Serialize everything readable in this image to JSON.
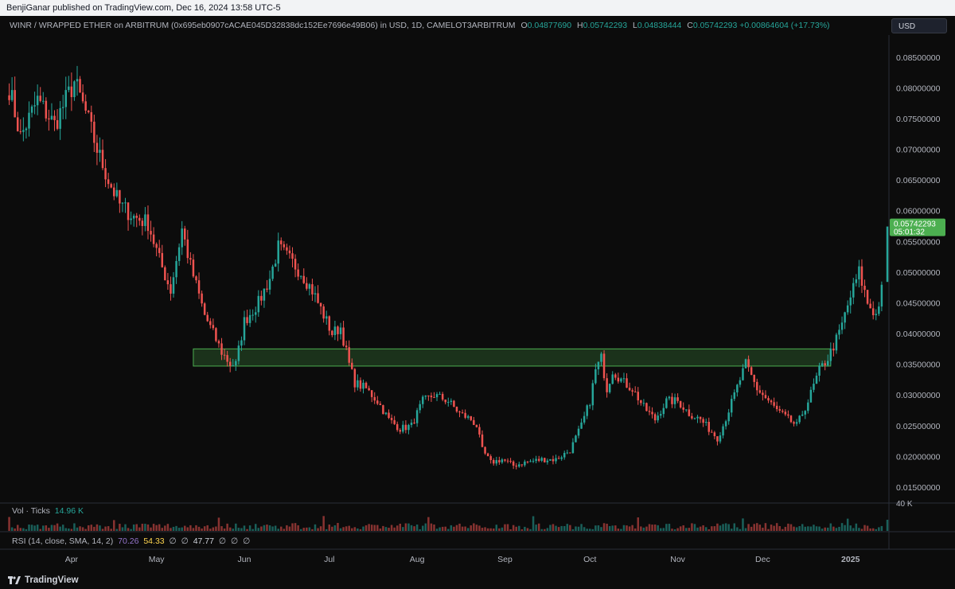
{
  "header": {
    "published": "BenjiGanar published on TradingView.com, Dec 16, 2024 13:58 UTC-5"
  },
  "legend": {
    "symbol": "WINR / WRAPPED ETHER on ARBITRUM (0x695eb0907cACAE045D32838dc152Ee7696e49B06) in USD, 1D, CAMELOT3ARBITRUM",
    "o_label": "O",
    "o_value": "0.04877690",
    "h_label": "H",
    "h_value": "0.05742293",
    "l_label": "L",
    "l_value": "0.04838444",
    "c_label": "C",
    "c_value": "0.05742293",
    "change": "+0.00864604 (+17.73%)"
  },
  "currency_button": "USD",
  "volume_pane": {
    "label": "Vol · Ticks",
    "value": "14.96 K",
    "axis_label": "40 K"
  },
  "rsi_pane": {
    "label": "RSI (14, close, SMA, 14, 2)",
    "v1": "70.26",
    "v2": "54.33",
    "v3": "47.77",
    "placeholder": "∅"
  },
  "footer": {
    "brand": "TradingView"
  },
  "colors": {
    "up": "#26a69a",
    "down": "#ef5350",
    "box_fill": "#1e3a1e",
    "box_stroke": "#4caf50",
    "price_tag": "#4caf50"
  },
  "chart_data": {
    "type": "candlestick",
    "y_ticks": [
      0.015,
      0.02,
      0.025,
      0.03,
      0.035,
      0.04,
      0.045,
      0.05,
      0.055,
      0.06,
      0.065,
      0.07,
      0.075,
      0.08,
      0.085
    ],
    "y_tick_labels": [
      "0.01500000",
      "0.02000000",
      "0.02500000",
      "0.03000000",
      "0.03500000",
      "0.04000000",
      "0.04500000",
      "0.05000000",
      "0.05500000",
      "0.06000000",
      "0.06500000",
      "0.07000000",
      "0.07500000",
      "0.08000000",
      "0.08500000"
    ],
    "ylim": [
      0.0124,
      0.0886
    ],
    "x_labels": [
      "Apr",
      "May",
      "Jun",
      "Jul",
      "Aug",
      "Sep",
      "Oct",
      "Nov",
      "Dec",
      "2025"
    ],
    "x_label_dates": [
      "2024-04-01",
      "2024-05-01",
      "2024-06-01",
      "2024-07-01",
      "2024-08-01",
      "2024-09-01",
      "2024-10-01",
      "2024-11-01",
      "2024-12-01",
      "2025-01-01"
    ],
    "range_start": "2024-03-09",
    "range_end": "2025-01-14",
    "current_price": "0.05742293",
    "countdown": "05:01:32",
    "support_zone": {
      "low": 0.0347,
      "high": 0.0375,
      "start": "2024-05-14",
      "end": "2024-12-25"
    },
    "close_anchors": [
      [
        "2024-03-10",
        0.08
      ],
      [
        "2024-03-14",
        0.072
      ],
      [
        "2024-03-20",
        0.078
      ],
      [
        "2024-03-26",
        0.074
      ],
      [
        "2024-04-02",
        0.081
      ],
      [
        "2024-04-06",
        0.076
      ],
      [
        "2024-04-10",
        0.07
      ],
      [
        "2024-04-14",
        0.065
      ],
      [
        "2024-04-18",
        0.061
      ],
      [
        "2024-04-23",
        0.059
      ],
      [
        "2024-04-28",
        0.058
      ],
      [
        "2024-05-02",
        0.052
      ],
      [
        "2024-05-06",
        0.047
      ],
      [
        "2024-05-10",
        0.057
      ],
      [
        "2024-05-13",
        0.051
      ],
      [
        "2024-05-18",
        0.043
      ],
      [
        "2024-05-24",
        0.037
      ],
      [
        "2024-05-27",
        0.035
      ],
      [
        "2024-05-29",
        0.035
      ],
      [
        "2024-06-01",
        0.042
      ],
      [
        "2024-06-06",
        0.045
      ],
      [
        "2024-06-10",
        0.049
      ],
      [
        "2024-06-13",
        0.054
      ],
      [
        "2024-06-17",
        0.052
      ],
      [
        "2024-06-21",
        0.05
      ],
      [
        "2024-06-25",
        0.047
      ],
      [
        "2024-06-29",
        0.043
      ],
      [
        "2024-07-02",
        0.04
      ],
      [
        "2024-07-05",
        0.041
      ],
      [
        "2024-07-08",
        0.035
      ],
      [
        "2024-07-10",
        0.032
      ],
      [
        "2024-07-14",
        0.031
      ],
      [
        "2024-07-18",
        0.029
      ],
      [
        "2024-07-22",
        0.026
      ],
      [
        "2024-07-26",
        0.0245
      ],
      [
        "2024-07-30",
        0.025
      ],
      [
        "2024-08-03",
        0.029
      ],
      [
        "2024-08-07",
        0.03
      ],
      [
        "2024-08-12",
        0.029
      ],
      [
        "2024-08-16",
        0.027
      ],
      [
        "2024-08-20",
        0.026
      ],
      [
        "2024-08-22",
        0.025
      ],
      [
        "2024-08-24",
        0.021
      ],
      [
        "2024-08-27",
        0.019
      ],
      [
        "2024-08-31",
        0.0195
      ],
      [
        "2024-09-04",
        0.0185
      ],
      [
        "2024-09-08",
        0.019
      ],
      [
        "2024-09-14",
        0.0195
      ],
      [
        "2024-09-19",
        0.0195
      ],
      [
        "2024-09-24",
        0.021
      ],
      [
        "2024-09-28",
        0.025
      ],
      [
        "2024-10-01",
        0.029
      ],
      [
        "2024-10-03",
        0.034
      ],
      [
        "2024-10-05",
        0.036
      ],
      [
        "2024-10-07",
        0.031
      ],
      [
        "2024-10-09",
        0.034
      ],
      [
        "2024-10-13",
        0.032
      ],
      [
        "2024-10-16",
        0.031
      ],
      [
        "2024-10-20",
        0.028
      ],
      [
        "2024-10-24",
        0.026
      ],
      [
        "2024-10-28",
        0.029
      ],
      [
        "2024-11-01",
        0.029
      ],
      [
        "2024-11-05",
        0.027
      ],
      [
        "2024-11-09",
        0.026
      ],
      [
        "2024-11-13",
        0.024
      ],
      [
        "2024-11-15",
        0.023
      ],
      [
        "2024-11-17",
        0.025
      ],
      [
        "2024-11-21",
        0.03
      ],
      [
        "2024-11-25",
        0.035
      ],
      [
        "2024-11-29",
        0.031
      ],
      [
        "2024-12-03",
        0.029
      ],
      [
        "2024-12-06",
        0.0275
      ],
      [
        "2024-12-10",
        0.026
      ],
      [
        "2024-12-13",
        0.025
      ],
      [
        "2024-12-17",
        0.029
      ],
      [
        "2024-12-21",
        0.034
      ],
      [
        "2024-12-24",
        0.036
      ],
      [
        "2024-12-28",
        0.04
      ],
      [
        "2025-01-01",
        0.046
      ],
      [
        "2025-01-04",
        0.05
      ],
      [
        "2025-01-07",
        0.045
      ],
      [
        "2025-01-10",
        0.043
      ],
      [
        "2025-01-12",
        0.047
      ]
    ]
  }
}
